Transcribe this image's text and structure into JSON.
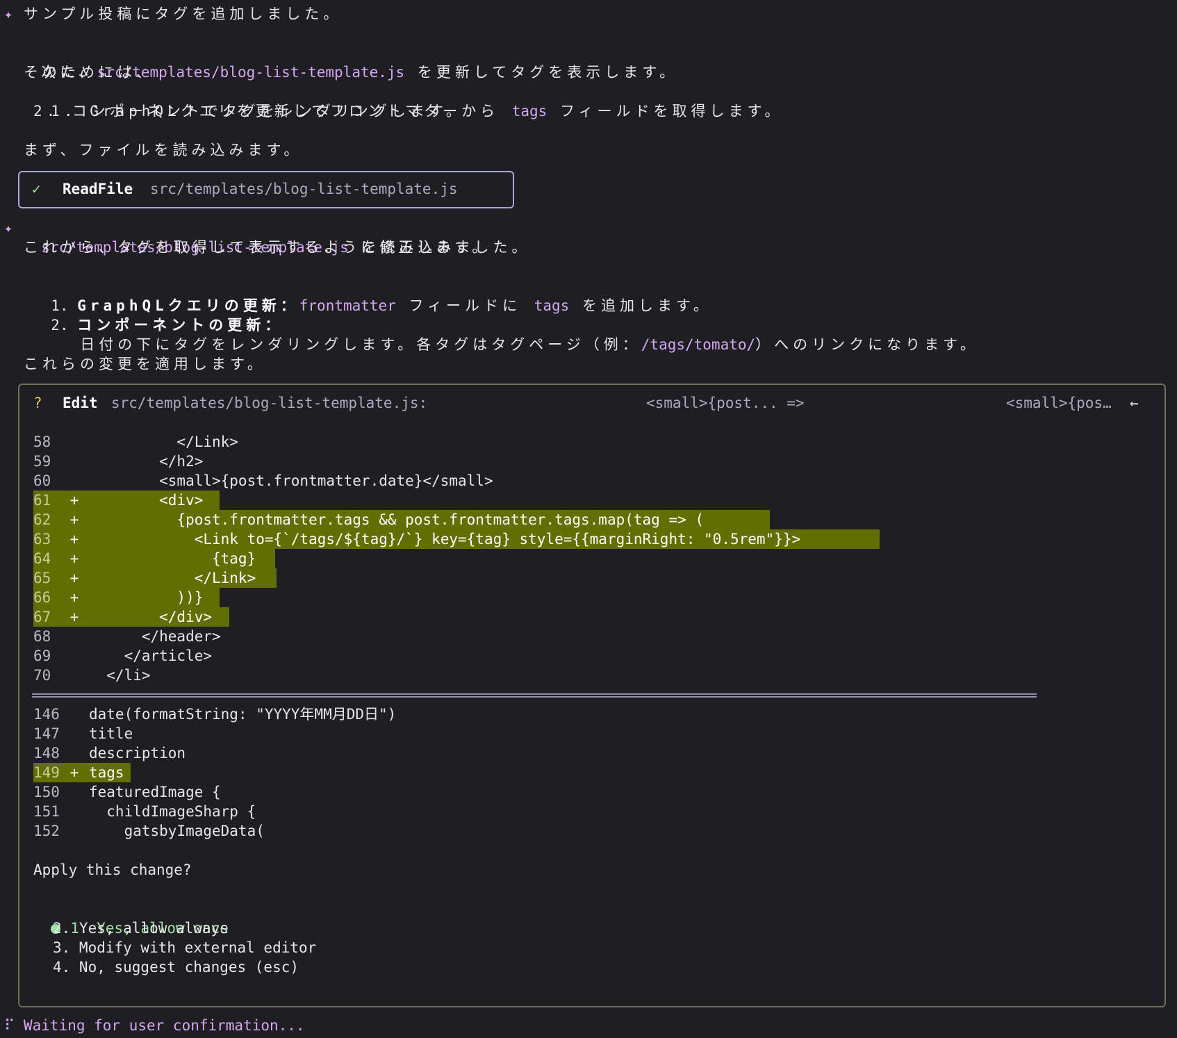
{
  "intro": {
    "line1": "サンプル投稿にタグを追加しました。",
    "next_prefix": "次に、",
    "next_file": "src/templates/blog-list-template.js",
    "next_suffix": " を更新してタグを表示します。",
    "line3": "そのためには、",
    "step1_prefix": "1. GraphQLクエリを更新してフロントマターから ",
    "step1_code": "tags",
    "step1_suffix": " フィールドを取得します。",
    "step2": "2. コンポーネントでタグをレンダリングします。",
    "read_first": "まず、ファイルを読み込みます。"
  },
  "readfile": {
    "check": "✓",
    "label": "ReadFile",
    "path": "src/templates/blog-list-template.js"
  },
  "after_read": {
    "file": "src/templates/blog-list-template.js",
    "suffix": " を読み込みました。",
    "line2": "これから、タグを取得して表示するように修正します。",
    "item1_num": "1.",
    "item1_bold": "GraphQLクエリの更新：",
    "item1_code1": "frontmatter",
    "item1_mid": " フィールドに ",
    "item1_code2": "tags",
    "item1_suffix": " を追加します。",
    "item2_num": "2.",
    "item2_bold": "コンポーネントの更新：",
    "item2_detail_prefix": "日付の下にタグをレンダリングします。各タグはタグページ（例：",
    "item2_detail_code": "/tags/tomato/",
    "item2_detail_suffix": "）へのリンクになります。",
    "apply_line": "これらの変更を適用します。"
  },
  "edit": {
    "question": "?",
    "label": "Edit",
    "path": "src/templates/blog-list-template.js:",
    "from": "<small>{post... =>",
    "to": "<small>{pos…",
    "arrow": "←"
  },
  "diff": {
    "block1": [
      {
        "n": "58",
        "mark": " ",
        "code": "          </Link>"
      },
      {
        "n": "59",
        "mark": " ",
        "code": "        </h2>"
      },
      {
        "n": "60",
        "mark": " ",
        "code": "        <small>{post.frontmatter.date}</small>"
      },
      {
        "n": "61",
        "mark": "+",
        "code": "        <div>"
      },
      {
        "n": "62",
        "mark": "+",
        "code": "          {post.frontmatter.tags && post.frontmatter.tags.map(tag => ("
      },
      {
        "n": "63",
        "mark": "+",
        "code": "            <Link to={`/tags/${tag}/`} key={tag} style={{marginRight: \"0.5rem\"}}>"
      },
      {
        "n": "64",
        "mark": "+",
        "code": "              {tag}"
      },
      {
        "n": "65",
        "mark": "+",
        "code": "            </Link>"
      },
      {
        "n": "66",
        "mark": "+",
        "code": "          ))}"
      },
      {
        "n": "67",
        "mark": "+",
        "code": "        </div>"
      },
      {
        "n": "68",
        "mark": " ",
        "code": "      </header>"
      },
      {
        "n": "69",
        "mark": " ",
        "code": "    </article>"
      },
      {
        "n": "70",
        "mark": " ",
        "code": "  </li>"
      }
    ],
    "block2": [
      {
        "n": "146",
        "mark": " ",
        "code": "date(formatString: \"YYYY年MM月DD日\")"
      },
      {
        "n": "147",
        "mark": " ",
        "code": "title"
      },
      {
        "n": "148",
        "mark": " ",
        "code": "description"
      },
      {
        "n": "149",
        "mark": "+",
        "code": "tags"
      },
      {
        "n": "150",
        "mark": " ",
        "code": "featuredImage {"
      },
      {
        "n": "151",
        "mark": " ",
        "code": "  childImageSharp {"
      },
      {
        "n": "152",
        "mark": " ",
        "code": "    gatsbyImageData("
      }
    ]
  },
  "prompt": {
    "question": "Apply this change?",
    "options": [
      "1. Yes, allow once",
      "2. Yes, allow always",
      "3. Modify with external editor",
      "4. No, suggest changes (esc)"
    ]
  },
  "status": {
    "spinner": "⠏",
    "text": "Waiting for user confirmation..."
  }
}
